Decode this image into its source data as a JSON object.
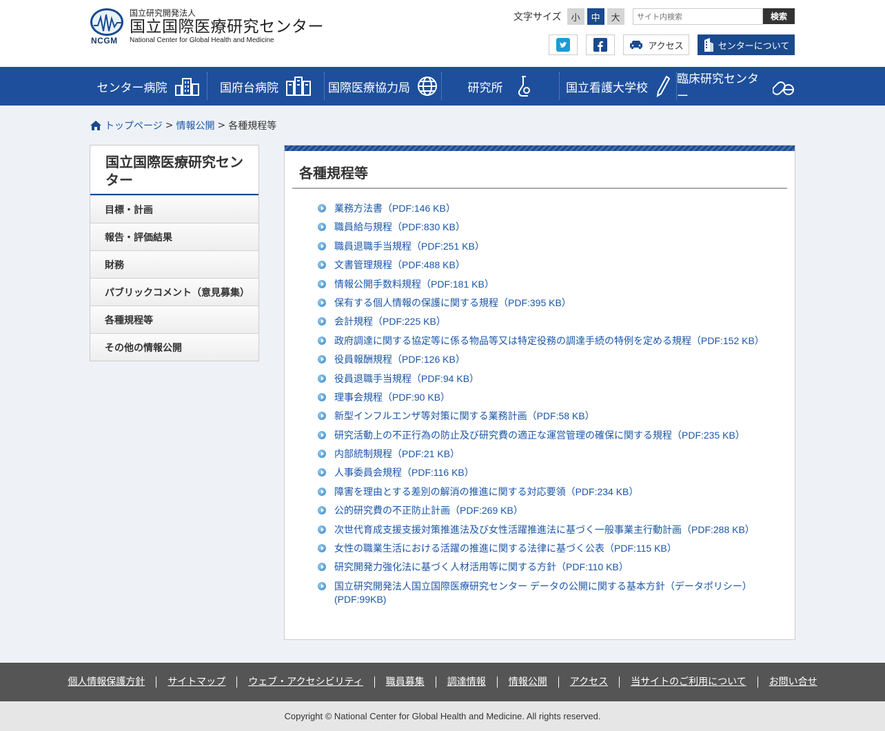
{
  "header": {
    "logo_sub": "国立研究開発法人",
    "logo_main": "国立国際医療研究センター",
    "logo_en": "National Center for Global Health and Medicine",
    "logo_abbr": "NCGM",
    "fontsize_label": "文字サイズ",
    "fontsize_options": [
      "小",
      "中",
      "大"
    ],
    "fontsize_active": "中",
    "search_placeholder": "サイト内検索",
    "search_button": "検索",
    "access_label": "アクセス",
    "about_label": "センターについて",
    "brand_color": "#1a4a8e"
  },
  "nav": {
    "items": [
      {
        "label": "センター病院",
        "icon": "hospital-building-icon"
      },
      {
        "label": "国府台病院",
        "icon": "building-icon"
      },
      {
        "label": "国際医療協力局",
        "icon": "globe-icon"
      },
      {
        "label": "研究所",
        "icon": "flask-icon"
      },
      {
        "label": "国立看護大学校",
        "icon": "pencil-icon"
      },
      {
        "label": "臨床研究センター",
        "icon": "pills-icon"
      }
    ],
    "color": "#1e4f9c"
  },
  "breadcrumb": {
    "home": "トップページ",
    "parent": "情報公開",
    "separator": ">",
    "current": "各種規程等"
  },
  "sidebar": {
    "title": "国立国際医療研究センター",
    "items": [
      "目標・計画",
      "報告・評価結果",
      "財務",
      "パブリックコメント（意見募集）",
      "各種規程等",
      "その他の情報公開"
    ]
  },
  "main": {
    "title": "各種規程等",
    "links": [
      "業務方法書（PDF:146 KB）",
      "職員給与規程（PDF:830 KB）",
      "職員退職手当規程（PDF:251 KB）",
      "文書管理規程（PDF:488 KB）",
      "情報公開手数料規程（PDF:181 KB）",
      "保有する個人情報の保護に関する規程（PDF:395 KB）",
      "会計規程（PDF:225 KB）",
      "政府調達に関する協定等に係る物品等又は特定役務の調達手続の特例を定める規程（PDF:152 KB）",
      "役員報酬規程（PDF:126 KB）",
      "役員退職手当規程（PDF:94 KB）",
      "理事会規程（PDF:90 KB）",
      "新型インフルエンザ等対策に関する業務計画（PDF:58 KB）",
      "研究活動上の不正行為の防止及び研究費の適正な運営管理の確保に関する規程（PDF:235 KB）",
      "内部統制規程（PDF:21 KB）",
      "人事委員会規程（PDF:116 KB）",
      "障害を理由とする差別の解消の推進に関する対応要領（PDF:234 KB）",
      "公的研究費の不正防止計画（PDF:269 KB）",
      "次世代育成支援支援対策推進法及び女性活躍推進法に基づく一般事業主行動計画（PDF:288 KB）",
      "女性の職業生活における活躍の推進に関する法律に基づく公表（PDF:115 KB）",
      "研究開発力強化法に基づく人材活用等に関する方針（PDF:110 KB）",
      "国立研究開発法人国立国際医療研究センター データの公開に関する基本方針（データポリシー）(PDF:99KB)"
    ]
  },
  "footer": {
    "links": [
      "個人情報保護方針",
      "サイトマップ",
      "ウェブ・アクセシビリティ",
      "職員募集",
      "調達情報",
      "情報公開",
      "アクセス",
      "当サイトのご利用について",
      "お問い合せ"
    ],
    "copyright": "Copyright © National Center for Global Health and Medicine. All rights reserved."
  }
}
